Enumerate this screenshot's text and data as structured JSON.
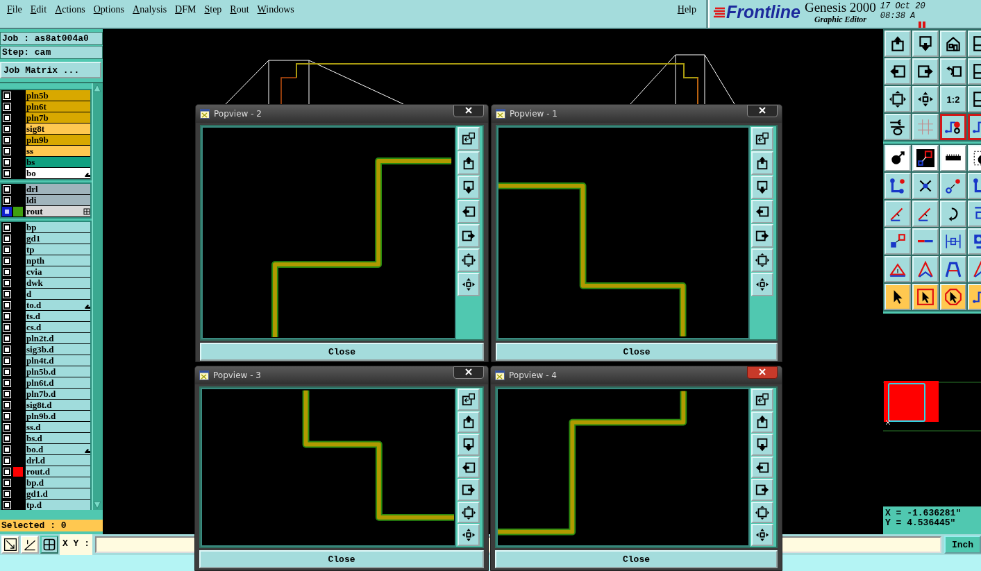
{
  "menu_bar": {
    "menus": [
      "File",
      "Edit",
      "Actions",
      "Options",
      "Analysis",
      "DFM",
      "Step",
      "Rout",
      "Windows"
    ],
    "help": "Help"
  },
  "brand": {
    "logo": "Frontline",
    "product": "Genesis 2000",
    "subtitle": "Graphic Editor",
    "date": "17 Oct 20",
    "time": "08:38 A"
  },
  "job_panel": {
    "job": "Job : as8at004a0",
    "step": "Step: cam",
    "matrix_button": "Job Matrix ...",
    "selected_count": "Selected : 0"
  },
  "layers": {
    "groups": [
      {
        "rows": [
          {
            "name": "pln5b",
            "color": "#d8a800",
            "selected": false
          },
          {
            "name": "pln6t",
            "color": "#d8a800",
            "selected": false
          },
          {
            "name": "pln7b",
            "color": "#d8a800",
            "selected": false
          },
          {
            "name": "sig8t",
            "color": "#ffc850",
            "selected": false
          },
          {
            "name": "pln9b",
            "color": "#d8a800",
            "selected": false
          },
          {
            "name": "ss",
            "color": "#ffc850",
            "selected": false
          },
          {
            "name": "bs",
            "color": "#10a080",
            "selected": false
          },
          {
            "name": "bo",
            "color": "#ffffff",
            "selected": false,
            "kind": "hand"
          }
        ]
      },
      {
        "rows": [
          {
            "name": "drl",
            "color": "#a0b4bc",
            "selected": false
          },
          {
            "name": "ldi",
            "color": "#a0b4bc",
            "selected": false
          },
          {
            "name": "rout",
            "color": "#d8d8d8",
            "selected": true,
            "swatch": {
              "color": "#40a010"
            },
            "kind": "grid"
          }
        ]
      },
      {
        "rows": [
          {
            "name": "bp",
            "color": "#a0dcdc",
            "selected": false
          },
          {
            "name": "gd1",
            "color": "#a0dcdc",
            "selected": false
          },
          {
            "name": "tp",
            "color": "#a0dcdc",
            "selected": false
          },
          {
            "name": "npth",
            "color": "#a0dcdc",
            "selected": false
          },
          {
            "name": "cvia",
            "color": "#a0dcdc",
            "selected": false
          },
          {
            "name": "dwk",
            "color": "#a0dcdc",
            "selected": false
          },
          {
            "name": "d",
            "color": "#a0dcdc",
            "selected": false
          },
          {
            "name": "to.d",
            "color": "#a0dcdc",
            "selected": false,
            "kind": "hand"
          },
          {
            "name": "ts.d",
            "color": "#a0dcdc",
            "selected": false
          },
          {
            "name": "cs.d",
            "color": "#a0dcdc",
            "selected": false
          },
          {
            "name": "pln2t.d",
            "color": "#a0dcdc",
            "selected": false
          },
          {
            "name": "sig3b.d",
            "color": "#a0dcdc",
            "selected": false
          },
          {
            "name": "pln4t.d",
            "color": "#a0dcdc",
            "selected": false
          },
          {
            "name": "pln5b.d",
            "color": "#a0dcdc",
            "selected": false
          },
          {
            "name": "pln6t.d",
            "color": "#a0dcdc",
            "selected": false
          },
          {
            "name": "pln7b.d",
            "color": "#a0dcdc",
            "selected": false
          },
          {
            "name": "sig8t.d",
            "color": "#a0dcdc",
            "selected": false
          },
          {
            "name": "pln9b.d",
            "color": "#a0dcdc",
            "selected": false
          },
          {
            "name": "ss.d",
            "color": "#a0dcdc",
            "selected": false
          },
          {
            "name": "bs.d",
            "color": "#a0dcdc",
            "selected": false
          },
          {
            "name": "bo.d",
            "color": "#a0dcdc",
            "selected": false,
            "kind": "hand"
          },
          {
            "name": "drl.d",
            "color": "#a0dcdc",
            "selected": false
          },
          {
            "name": "rout.d",
            "color": "#a0dcdc",
            "selected": false,
            "swatch": {
              "color": "#ff0000"
            }
          },
          {
            "name": "bp.d",
            "color": "#a0dcdc",
            "selected": false
          },
          {
            "name": "gd1.d",
            "color": "#a0dcdc",
            "selected": false
          },
          {
            "name": "tp.d",
            "color": "#a0dcdc",
            "selected": false
          }
        ]
      }
    ]
  },
  "popviews": [
    {
      "title": "Popview - 2",
      "close": "Close",
      "active": false
    },
    {
      "title": "Popview - 1",
      "close": "Close",
      "active": false
    },
    {
      "title": "Popview - 3",
      "close": "Close",
      "active": false
    },
    {
      "title": "Popview - 4",
      "close": "Close",
      "active": true
    }
  ],
  "tool_panel": {
    "groups": [
      {
        "rows": [
          [
            {
              "kind": "plain",
              "active": false
            },
            {
              "kind": "plain",
              "active": false
            },
            {
              "kind": "plain",
              "active": false
            },
            {
              "kind": "plain",
              "active": false
            }
          ],
          [
            {
              "kind": "plain",
              "active": false
            },
            {
              "kind": "plain",
              "active": false
            },
            {
              "kind": "plain",
              "active": false
            },
            {
              "kind": "plain",
              "active": false
            }
          ],
          [
            {
              "kind": "plain",
              "active": false
            },
            {
              "kind": "plain",
              "active": false
            },
            {
              "kind": "plain",
              "active": false,
              "label": "1:2"
            },
            {
              "kind": "plain",
              "active": false
            }
          ],
          [
            {
              "kind": "plain",
              "active": false
            },
            {
              "kind": "plain",
              "active": false
            },
            {
              "kind": "plain",
              "active": true
            },
            {
              "kind": "plain",
              "active": true
            }
          ]
        ]
      },
      {
        "rows": [
          [
            {
              "kind": "white",
              "active": false
            },
            {
              "kind": "white",
              "active": false
            },
            {
              "kind": "white",
              "active": false
            },
            {
              "kind": "white",
              "active": false
            }
          ],
          [
            {
              "kind": "plain",
              "active": false
            },
            {
              "kind": "plain",
              "active": false
            },
            {
              "kind": "plain",
              "active": false
            },
            {
              "kind": "plain",
              "active": false
            }
          ],
          [
            {
              "kind": "plain",
              "active": false
            },
            {
              "kind": "plain",
              "active": false
            },
            {
              "kind": "plain",
              "active": false
            },
            {
              "kind": "plain",
              "active": false
            }
          ],
          [
            {
              "kind": "plain",
              "active": false
            },
            {
              "kind": "plain",
              "active": false
            },
            {
              "kind": "plain",
              "active": false
            },
            {
              "kind": "plain",
              "active": false
            }
          ],
          [
            {
              "kind": "plain",
              "active": false
            },
            {
              "kind": "plain",
              "active": false
            },
            {
              "kind": "plain",
              "active": false
            },
            {
              "kind": "plain",
              "active": false
            }
          ],
          [
            {
              "kind": "orange",
              "active": false
            },
            {
              "kind": "orange",
              "active": false
            },
            {
              "kind": "orange",
              "active": false
            },
            {
              "kind": "orange",
              "active": false
            }
          ]
        ]
      }
    ]
  },
  "coordinates": {
    "x": "X = -1.636281\"",
    "y": "Y = 4.536445\""
  },
  "command_bar": {
    "label": "X Y :",
    "units_button": "Inch"
  }
}
